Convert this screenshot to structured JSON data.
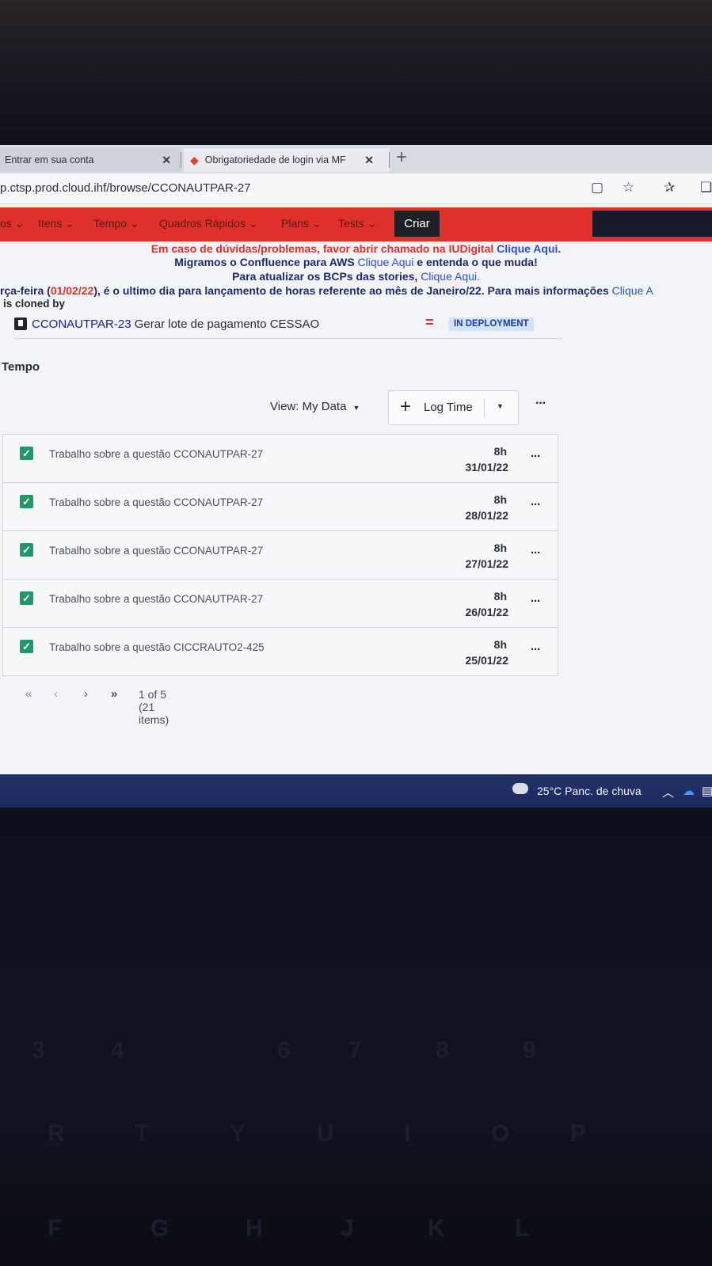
{
  "browser": {
    "tabs": [
      {
        "label": "Entrar em sua conta"
      },
      {
        "label": "Obrigatoriedade de login via MF"
      }
    ],
    "url": "p.ctsp.prod.cloud.ihf/browse/CCONAUTPAR-27",
    "icons": [
      "reader-mode-icon",
      "favorite-add-icon",
      "favorites-icon",
      "collections-icon"
    ]
  },
  "nav": {
    "items": [
      "os",
      "Itens",
      "Tempo",
      "Quadros Rápidos",
      "Plans",
      "Tests"
    ],
    "create_label": "Criar"
  },
  "banners": {
    "line1_red": "Em caso de dúvidas/problemas, favor abrir chamado na IUDigital",
    "line1_link": "Clique Aqui.",
    "line2_a": "Migramos o Confluence para AWS",
    "line2_link": "Clique Aqui",
    "line2_b": "e entenda o que muda!",
    "line3_a": "Para atualizar os BCPs das stories,",
    "line3_link": "Clique Aqui.",
    "line4_a": "rça-feira (",
    "line4_date": "01/02/22",
    "line4_b": "), é o ultimo dia para lançamento de horas referente ao mês de Janeiro/22. Para mais informações",
    "line4_link": "Clique A"
  },
  "links": {
    "cloned_label": "is cloned by",
    "issue_key": "CCONAUTPAR-23",
    "issue_title": "Gerar lote de pagamento CESSAO",
    "priority_glyph": "=",
    "status": "IN DEPLOYMENT"
  },
  "tempo": {
    "heading": "Tempo",
    "view_label": "View: My Data",
    "log_time_label": "Log Time",
    "more": "···",
    "worklogs": [
      {
        "description": "Trabalho sobre a questão CCONAUTPAR-27",
        "hours": "8h",
        "date": "31/01/22"
      },
      {
        "description": "Trabalho sobre a questão CCONAUTPAR-27",
        "hours": "8h",
        "date": "28/01/22"
      },
      {
        "description": "Trabalho sobre a questão CCONAUTPAR-27",
        "hours": "8h",
        "date": "27/01/22"
      },
      {
        "description": "Trabalho sobre a questão CCONAUTPAR-27",
        "hours": "8h",
        "date": "26/01/22"
      },
      {
        "description": "Trabalho sobre a questão CICCRAUTO2-425",
        "hours": "8h",
        "date": "25/01/22"
      }
    ],
    "pagination": "1 of 5 (21 items)"
  },
  "taskbar": {
    "weather": "25°C  Panc. de chuva"
  }
}
